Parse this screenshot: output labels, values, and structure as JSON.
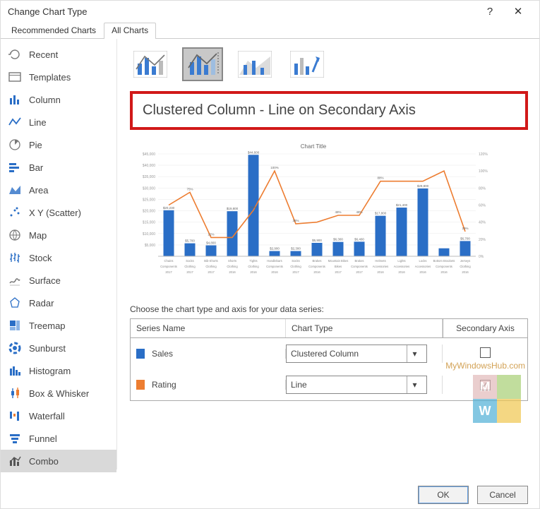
{
  "window": {
    "title": "Change Chart Type",
    "help": "?",
    "close": "✕"
  },
  "tabs": [
    {
      "label": "Recommended Charts",
      "active": false
    },
    {
      "label": "All Charts",
      "active": true
    }
  ],
  "sidebar": {
    "items": [
      {
        "label": "Recent"
      },
      {
        "label": "Templates"
      },
      {
        "label": "Column"
      },
      {
        "label": "Line"
      },
      {
        "label": "Pie"
      },
      {
        "label": "Bar"
      },
      {
        "label": "Area"
      },
      {
        "label": "X Y (Scatter)"
      },
      {
        "label": "Map"
      },
      {
        "label": "Stock"
      },
      {
        "label": "Surface"
      },
      {
        "label": "Radar"
      },
      {
        "label": "Treemap"
      },
      {
        "label": "Sunburst"
      },
      {
        "label": "Histogram"
      },
      {
        "label": "Box & Whisker"
      },
      {
        "label": "Waterfall"
      },
      {
        "label": "Funnel"
      },
      {
        "label": "Combo",
        "selected": true
      }
    ]
  },
  "combo": {
    "chart_name": "Clustered Column - Line on Secondary Axis"
  },
  "preview": {
    "title": "Chart Title"
  },
  "series_section": {
    "prompt": "Choose the chart type and axis for your data series:",
    "headers": {
      "name": "Series Name",
      "type": "Chart Type",
      "secondary": "Secondary Axis"
    },
    "rows": [
      {
        "swatch": "blue",
        "name": "Sales",
        "type": "Clustered Column",
        "secondary": false
      },
      {
        "swatch": "orange",
        "name": "Rating",
        "type": "Line",
        "secondary": true
      }
    ]
  },
  "footer": {
    "ok": "OK",
    "cancel": "Cancel"
  },
  "chart_data": {
    "type": "combo",
    "title": "Chart Title",
    "y1_label": "",
    "y2_label": "",
    "y1_range": [
      0,
      45000
    ],
    "y2_range": [
      0,
      120
    ],
    "y1_ticks": [
      5000,
      10000,
      15000,
      20000,
      25000,
      30000,
      35000,
      40000,
      45000
    ],
    "y2_ticks": [
      0,
      20,
      40,
      60,
      80,
      100,
      120
    ],
    "y1_tick_labels": [
      "$5,000",
      "$10,000",
      "$15,000",
      "$20,000",
      "$25,000",
      "$30,000",
      "$35,000",
      "$40,000",
      "$45,000"
    ],
    "y2_tick_labels": [
      "0%",
      "20%",
      "40%",
      "60%",
      "80%",
      "100%",
      "120%"
    ],
    "categories": [
      {
        "cat": "Chains",
        "group": "Components",
        "year": "2017"
      },
      {
        "cat": "Socks",
        "group": "Clothing",
        "year": "2017"
      },
      {
        "cat": "Bib-Shorts",
        "group": "Clothing",
        "year": "2017"
      },
      {
        "cat": "Shorts",
        "group": "Clothing",
        "year": "2016"
      },
      {
        "cat": "Tights",
        "group": "Clothing",
        "year": "2016"
      },
      {
        "cat": "Handlebars",
        "group": "Components",
        "year": "2016"
      },
      {
        "cat": "Socks",
        "group": "Clothing",
        "year": "2017"
      },
      {
        "cat": "Brakes",
        "group": "Components",
        "year": "2016"
      },
      {
        "cat": "Mountain Bikes",
        "group": "Bikes",
        "year": "2017"
      },
      {
        "cat": "Brakes",
        "group": "Components",
        "year": "2017"
      },
      {
        "cat": "Helmets",
        "group": "Accessories",
        "year": "2016"
      },
      {
        "cat": "Lights",
        "group": "Accessories",
        "year": "2016"
      },
      {
        "cat": "Locks",
        "group": "Accessories",
        "year": "2016"
      },
      {
        "cat": "Bottom Brackets",
        "group": "Components",
        "year": "2016"
      },
      {
        "cat": "Jerseys",
        "group": "Clothing",
        "year": "2016"
      }
    ],
    "series": [
      {
        "name": "Sales",
        "type": "bar",
        "axis": "primary",
        "color": "#2a6ec6",
        "values": [
          20230,
          5700,
          4800,
          19800,
          44600,
          2300,
          2300,
          5900,
          6300,
          6400,
          17800,
          21400,
          29800,
          3500,
          6700
        ],
        "labels": [
          "$20,230",
          "$5,700",
          "$4,800",
          "$19,800",
          "$44,600",
          "$2,900",
          "$2,300",
          "$5,900",
          "$6,300",
          "$6,400",
          "$17,800",
          "$21,400",
          "$29,800",
          "",
          "$6,700"
        ]
      },
      {
        "name": "Rating",
        "type": "line",
        "axis": "secondary",
        "color": "#ed7d31",
        "values": [
          60,
          75,
          22,
          22,
          54,
          100,
          38,
          40,
          48,
          48,
          88,
          88,
          88,
          100,
          29
        ],
        "labels": [
          "",
          "75%",
          "22%",
          "",
          "54%",
          "100%",
          "38%",
          "",
          "48%",
          "48%",
          "88%",
          "",
          "",
          "",
          "29%"
        ]
      }
    ]
  }
}
